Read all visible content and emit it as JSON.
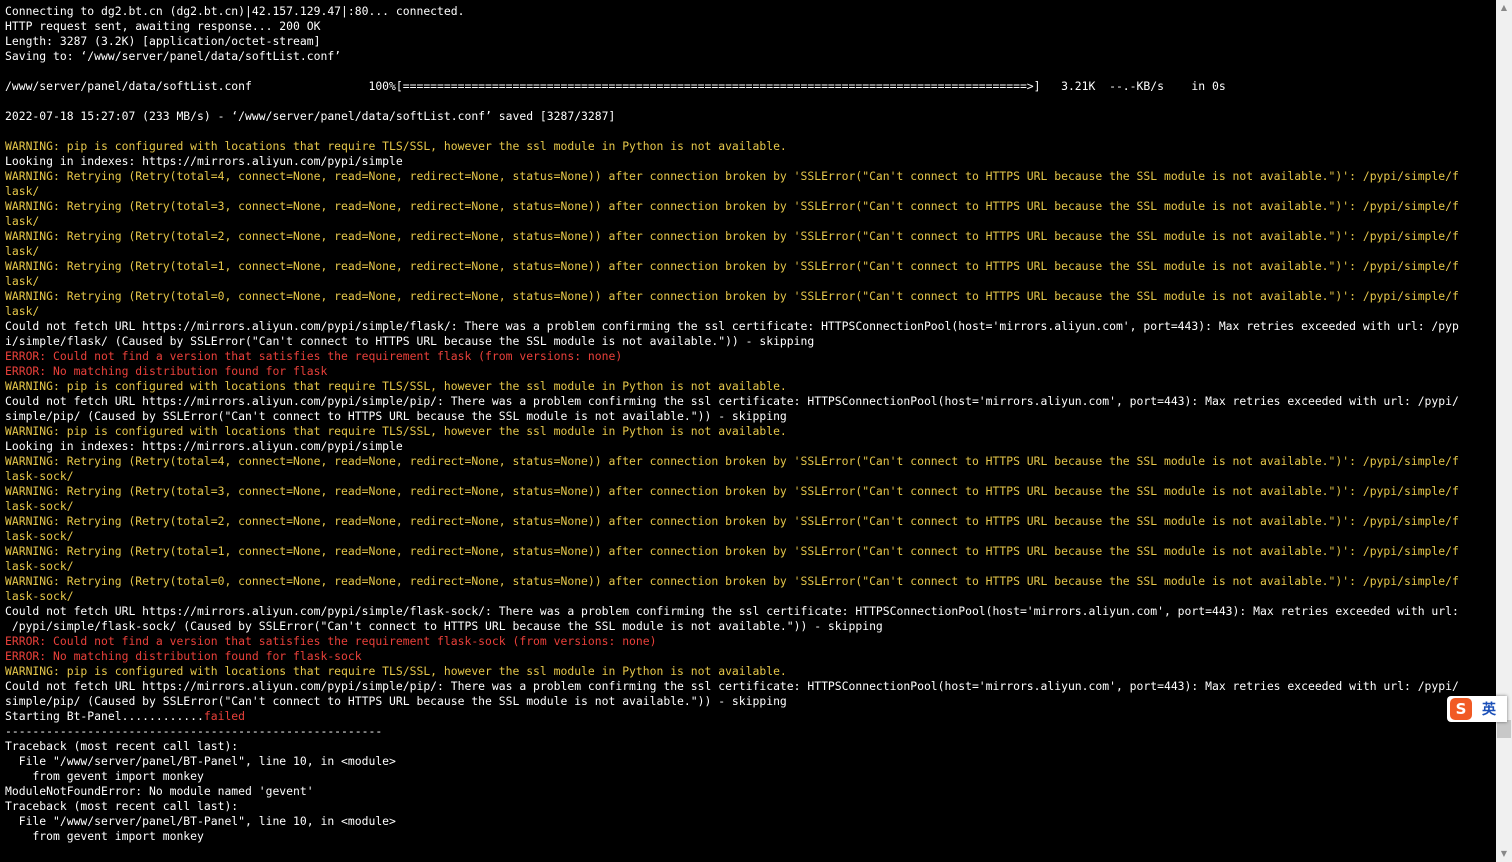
{
  "colors": {
    "background": "#000000",
    "normal_text": "#ffffff",
    "warning_text": "#e6c74a",
    "error_text": "#e8403a"
  },
  "terminal": {
    "lines": [
      [
        {
          "t": "Connecting to dg2.bt.cn (dg2.bt.cn)|42.157.129.47|:80... connected.",
          "c": "w"
        }
      ],
      [
        {
          "t": "HTTP request sent, awaiting response... 200 OK",
          "c": "w"
        }
      ],
      [
        {
          "t": "Length: 3287 (3.2K) [application/octet-stream]",
          "c": "w"
        }
      ],
      [
        {
          "t": "Saving to: ‘/www/server/panel/data/softList.conf’",
          "c": "w"
        }
      ],
      [
        {
          "t": "",
          "c": "w"
        }
      ],
      [
        {
          "t": "/www/server/panel/data/softList.conf                 100%[===========================================================================================>]   3.21K  --.-KB/s    in 0s",
          "c": "w"
        }
      ],
      [
        {
          "t": "",
          "c": "w"
        }
      ],
      [
        {
          "t": "2022-07-18 15:27:07 (233 MB/s) - ‘/www/server/panel/data/softList.conf’ saved [3287/3287]",
          "c": "w"
        }
      ],
      [
        {
          "t": "",
          "c": "w"
        }
      ],
      [
        {
          "t": "WARNING: pip is configured with locations that require TLS/SSL, however the ssl module in Python is not available.",
          "c": "y"
        }
      ],
      [
        {
          "t": "Looking in indexes: https://mirrors.aliyun.com/pypi/simple",
          "c": "w"
        }
      ],
      [
        {
          "t": "WARNING: Retrying (Retry(total=4, connect=None, read=None, redirect=None, status=None)) after connection broken by 'SSLError(\"Can't connect to HTTPS URL because the SSL module is not available.\")': /pypi/simple/f",
          "c": "y"
        }
      ],
      [
        {
          "t": "lask/",
          "c": "y"
        }
      ],
      [
        {
          "t": "WARNING: Retrying (Retry(total=3, connect=None, read=None, redirect=None, status=None)) after connection broken by 'SSLError(\"Can't connect to HTTPS URL because the SSL module is not available.\")': /pypi/simple/f",
          "c": "y"
        }
      ],
      [
        {
          "t": "lask/",
          "c": "y"
        }
      ],
      [
        {
          "t": "WARNING: Retrying (Retry(total=2, connect=None, read=None, redirect=None, status=None)) after connection broken by 'SSLError(\"Can't connect to HTTPS URL because the SSL module is not available.\")': /pypi/simple/f",
          "c": "y"
        }
      ],
      [
        {
          "t": "lask/",
          "c": "y"
        }
      ],
      [
        {
          "t": "WARNING: Retrying (Retry(total=1, connect=None, read=None, redirect=None, status=None)) after connection broken by 'SSLError(\"Can't connect to HTTPS URL because the SSL module is not available.\")': /pypi/simple/f",
          "c": "y"
        }
      ],
      [
        {
          "t": "lask/",
          "c": "y"
        }
      ],
      [
        {
          "t": "WARNING: Retrying (Retry(total=0, connect=None, read=None, redirect=None, status=None)) after connection broken by 'SSLError(\"Can't connect to HTTPS URL because the SSL module is not available.\")': /pypi/simple/f",
          "c": "y"
        }
      ],
      [
        {
          "t": "lask/",
          "c": "y"
        }
      ],
      [
        {
          "t": "Could not fetch URL https://mirrors.aliyun.com/pypi/simple/flask/: There was a problem confirming the ssl certificate: HTTPSConnectionPool(host='mirrors.aliyun.com', port=443): Max retries exceeded with url: /pyp",
          "c": "w"
        }
      ],
      [
        {
          "t": "i/simple/flask/ (Caused by SSLError(\"Can't connect to HTTPS URL because the SSL module is not available.\")) - skipping",
          "c": "w"
        }
      ],
      [
        {
          "t": "ERROR: Could not find a version that satisfies the requirement flask (from versions: none)",
          "c": "r"
        }
      ],
      [
        {
          "t": "ERROR: No matching distribution found for flask",
          "c": "r"
        }
      ],
      [
        {
          "t": "WARNING: pip is configured with locations that require TLS/SSL, however the ssl module in Python is not available.",
          "c": "y"
        }
      ],
      [
        {
          "t": "Could not fetch URL https://mirrors.aliyun.com/pypi/simple/pip/: There was a problem confirming the ssl certificate: HTTPSConnectionPool(host='mirrors.aliyun.com', port=443): Max retries exceeded with url: /pypi/",
          "c": "w"
        }
      ],
      [
        {
          "t": "simple/pip/ (Caused by SSLError(\"Can't connect to HTTPS URL because the SSL module is not available.\")) - skipping",
          "c": "w"
        }
      ],
      [
        {
          "t": "WARNING: pip is configured with locations that require TLS/SSL, however the ssl module in Python is not available.",
          "c": "y"
        }
      ],
      [
        {
          "t": "Looking in indexes: https://mirrors.aliyun.com/pypi/simple",
          "c": "w"
        }
      ],
      [
        {
          "t": "WARNING: Retrying (Retry(total=4, connect=None, read=None, redirect=None, status=None)) after connection broken by 'SSLError(\"Can't connect to HTTPS URL because the SSL module is not available.\")': /pypi/simple/f",
          "c": "y"
        }
      ],
      [
        {
          "t": "lask-sock/",
          "c": "y"
        }
      ],
      [
        {
          "t": "WARNING: Retrying (Retry(total=3, connect=None, read=None, redirect=None, status=None)) after connection broken by 'SSLError(\"Can't connect to HTTPS URL because the SSL module is not available.\")': /pypi/simple/f",
          "c": "y"
        }
      ],
      [
        {
          "t": "lask-sock/",
          "c": "y"
        }
      ],
      [
        {
          "t": "WARNING: Retrying (Retry(total=2, connect=None, read=None, redirect=None, status=None)) after connection broken by 'SSLError(\"Can't connect to HTTPS URL because the SSL module is not available.\")': /pypi/simple/f",
          "c": "y"
        }
      ],
      [
        {
          "t": "lask-sock/",
          "c": "y"
        }
      ],
      [
        {
          "t": "WARNING: Retrying (Retry(total=1, connect=None, read=None, redirect=None, status=None)) after connection broken by 'SSLError(\"Can't connect to HTTPS URL because the SSL module is not available.\")': /pypi/simple/f",
          "c": "y"
        }
      ],
      [
        {
          "t": "lask-sock/",
          "c": "y"
        }
      ],
      [
        {
          "t": "WARNING: Retrying (Retry(total=0, connect=None, read=None, redirect=None, status=None)) after connection broken by 'SSLError(\"Can't connect to HTTPS URL because the SSL module is not available.\")': /pypi/simple/f",
          "c": "y"
        }
      ],
      [
        {
          "t": "lask-sock/",
          "c": "y"
        }
      ],
      [
        {
          "t": "Could not fetch URL https://mirrors.aliyun.com/pypi/simple/flask-sock/: There was a problem confirming the ssl certificate: HTTPSConnectionPool(host='mirrors.aliyun.com', port=443): Max retries exceeded with url:",
          "c": "w"
        }
      ],
      [
        {
          "t": " /pypi/simple/flask-sock/ (Caused by SSLError(\"Can't connect to HTTPS URL because the SSL module is not available.\")) - skipping",
          "c": "w"
        }
      ],
      [
        {
          "t": "ERROR: Could not find a version that satisfies the requirement flask-sock (from versions: none)",
          "c": "r"
        }
      ],
      [
        {
          "t": "ERROR: No matching distribution found for flask-sock",
          "c": "r"
        }
      ],
      [
        {
          "t": "WARNING: pip is configured with locations that require TLS/SSL, however the ssl module in Python is not available.",
          "c": "y"
        }
      ],
      [
        {
          "t": "Could not fetch URL https://mirrors.aliyun.com/pypi/simple/pip/: There was a problem confirming the ssl certificate: HTTPSConnectionPool(host='mirrors.aliyun.com', port=443): Max retries exceeded with url: /pypi/",
          "c": "w"
        }
      ],
      [
        {
          "t": "simple/pip/ (Caused by SSLError(\"Can't connect to HTTPS URL because the SSL module is not available.\")) - skipping",
          "c": "w"
        }
      ],
      [
        {
          "t": "Starting Bt-Panel............",
          "c": "w"
        },
        {
          "t": "failed",
          "c": "r"
        }
      ],
      [
        {
          "t": "-------------------------------------------------------",
          "c": "w"
        }
      ],
      [
        {
          "t": "Traceback (most recent call last):",
          "c": "w"
        }
      ],
      [
        {
          "t": "  File \"/www/server/panel/BT-Panel\", line 10, in <module>",
          "c": "w"
        }
      ],
      [
        {
          "t": "    from gevent import monkey",
          "c": "w"
        }
      ],
      [
        {
          "t": "ModuleNotFoundError: No module named 'gevent'",
          "c": "w"
        }
      ],
      [
        {
          "t": "Traceback (most recent call last):",
          "c": "w"
        }
      ],
      [
        {
          "t": "  File \"/www/server/panel/BT-Panel\", line 10, in <module>",
          "c": "w"
        }
      ],
      [
        {
          "t": "    from gevent import monkey",
          "c": "w"
        }
      ]
    ]
  },
  "ime": {
    "logo": "S",
    "language": "英"
  }
}
